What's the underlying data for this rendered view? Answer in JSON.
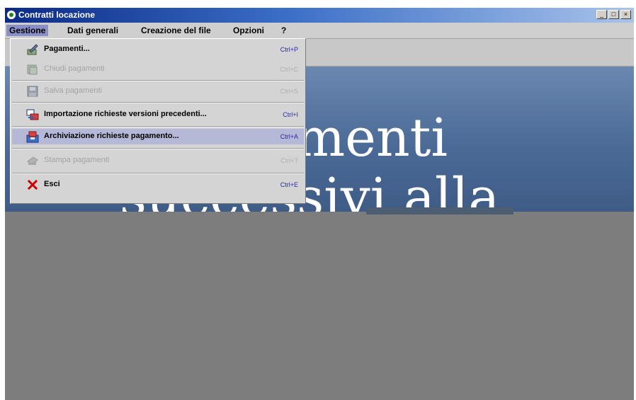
{
  "window": {
    "title": "Contratti locazione",
    "buttons": {
      "minimize": "_",
      "maximize": "□",
      "close": "×"
    }
  },
  "menubar": {
    "items": [
      {
        "label": "Gestione",
        "active": true
      },
      {
        "label": "Dati generali"
      },
      {
        "label": "Creazione del file"
      },
      {
        "label": "Opzioni"
      },
      {
        "label": "?"
      }
    ]
  },
  "hero": {
    "line1": "menti",
    "line2": "successivi alla"
  },
  "dropdown": {
    "items": [
      {
        "label": "Pagamenti...",
        "shortcut": "Ctrl+P",
        "icon": "pen-icon",
        "enabled": true
      },
      {
        "label": "Chiudi pagamenti",
        "shortcut": "Ctrl+C",
        "icon": "folder-close-icon",
        "enabled": false
      },
      {
        "label": "Salva pagamenti",
        "shortcut": "Ctrl+S",
        "icon": "floppy-disk-icon",
        "enabled": false
      },
      {
        "label": "Importazione richieste versioni precedenti...",
        "shortcut": "Ctrl+I",
        "icon": "import-icon",
        "enabled": true
      },
      {
        "label": "Archiviazione richieste pagamento...",
        "shortcut": "Ctrl+A",
        "icon": "archive-icon",
        "enabled": true,
        "selected": true
      },
      {
        "label": "Stampa pagamenti",
        "shortcut": "Ctrl+T",
        "icon": "printer-icon",
        "enabled": false
      },
      {
        "label": "Esci",
        "shortcut": "Ctrl+E",
        "icon": "exit-x-icon",
        "enabled": true
      }
    ]
  },
  "colors": {
    "title_bar": "#0b2a86",
    "menu_active": "#8b8fc7",
    "menu_selected_item": "#b6b8d8",
    "hero_background": "#4b6a96",
    "panel_grey": "#7d7d7d",
    "exit_icon": "#cc0000"
  }
}
